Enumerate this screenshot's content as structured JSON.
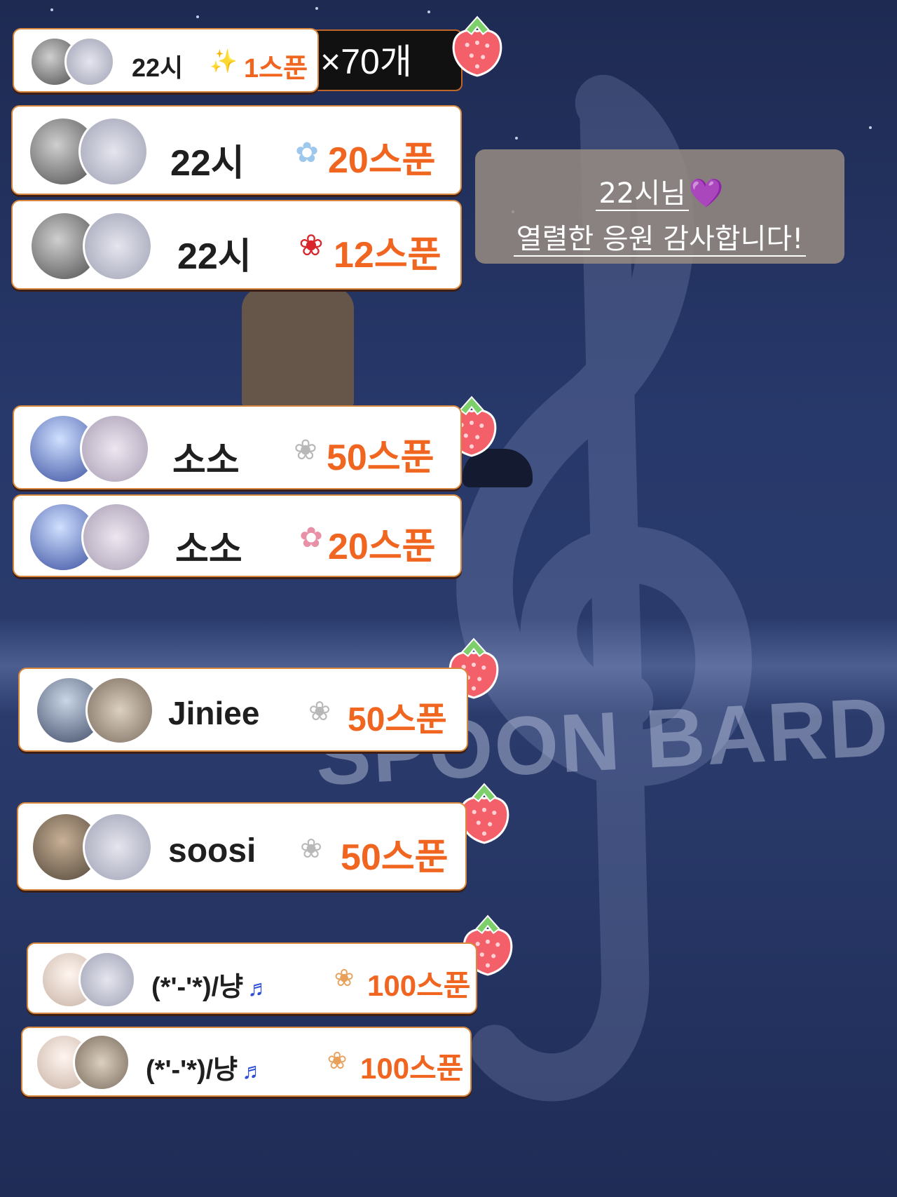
{
  "background": {
    "watermark": "SPOON BARD"
  },
  "top_badge": {
    "text": "×70개"
  },
  "thanks_note": {
    "line1": "22시님",
    "line1_emoji": "💜",
    "line2": "열렬한 응원 감사합니다!"
  },
  "donations": [
    {
      "user": "22시",
      "gift_icon": "sparkle-icon",
      "amount": "1스푼"
    },
    {
      "user": "22시",
      "gift_icon": "cotton-candy-icon",
      "amount": "20스푼"
    },
    {
      "user": "22시",
      "gift_icon": "rose-icon",
      "amount": "12스푼"
    },
    {
      "user": "소소",
      "gift_icon": "bunny-icon",
      "amount": "50스푼"
    },
    {
      "user": "소소",
      "gift_icon": "bouquet-icon",
      "amount": "20스푼"
    },
    {
      "user": "Jiniee",
      "gift_icon": "bunny-icon",
      "amount": "50스푼"
    },
    {
      "user": "soosi",
      "gift_icon": "bunny-icon",
      "amount": "50스푼"
    },
    {
      "user": "(*'-'*)/냥",
      "user_suffix": "♬",
      "gift_icon": "bunny-flower-icon",
      "amount": "100스푼"
    },
    {
      "user": "(*'-'*)/냥",
      "user_suffix": "♬",
      "gift_icon": "bunny-flower-icon",
      "amount": "100스푼"
    }
  ],
  "colors": {
    "amount": "#f0651f",
    "card_border": "#d9893f",
    "note": "#2f4fd8",
    "sticker": "#f4606a"
  }
}
